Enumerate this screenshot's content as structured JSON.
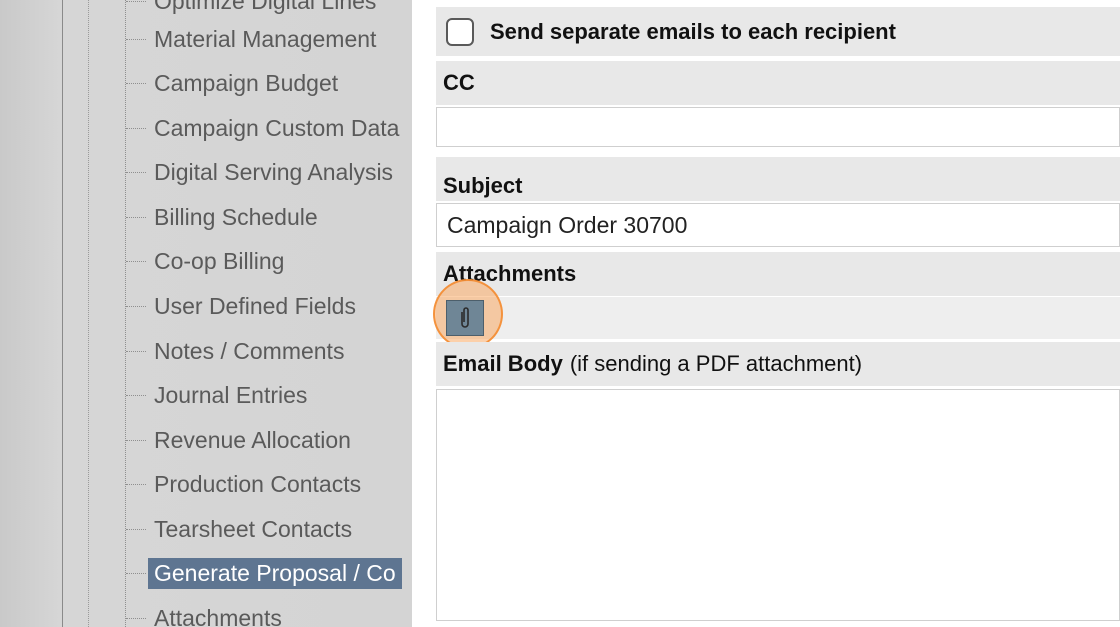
{
  "sidebar": {
    "items": [
      {
        "label": "Optimize Digital Lines",
        "selected": false
      },
      {
        "label": "Material Management",
        "selected": false
      },
      {
        "label": "Campaign Budget",
        "selected": false
      },
      {
        "label": "Campaign Custom Data",
        "selected": false
      },
      {
        "label": "Digital Serving Analysis",
        "selected": false
      },
      {
        "label": "Billing Schedule",
        "selected": false
      },
      {
        "label": "Co-op Billing",
        "selected": false
      },
      {
        "label": "User Defined Fields",
        "selected": false
      },
      {
        "label": "Notes / Comments",
        "selected": false
      },
      {
        "label": "Journal Entries",
        "selected": false
      },
      {
        "label": "Revenue Allocation",
        "selected": false
      },
      {
        "label": "Production Contacts",
        "selected": false
      },
      {
        "label": "Tearsheet Contacts",
        "selected": false
      },
      {
        "label": "Generate Proposal / Co",
        "selected": true
      },
      {
        "label": "Attachments",
        "selected": false
      }
    ]
  },
  "form": {
    "separate_emails": {
      "label": "Send separate emails to each recipient",
      "checked": false
    },
    "cc": {
      "label": "CC",
      "value": ""
    },
    "subject": {
      "label": "Subject",
      "value": "Campaign Order 30700"
    },
    "attachments": {
      "label": "Attachments",
      "button_icon": "paperclip-icon"
    },
    "email_body": {
      "label": "Email Body",
      "hint": "(if sending a PDF attachment)",
      "value": ""
    }
  },
  "colors": {
    "selected_item_bg": "#5e7591",
    "attach_button_bg": "#6f8696",
    "click_highlight": "#f48c32"
  }
}
